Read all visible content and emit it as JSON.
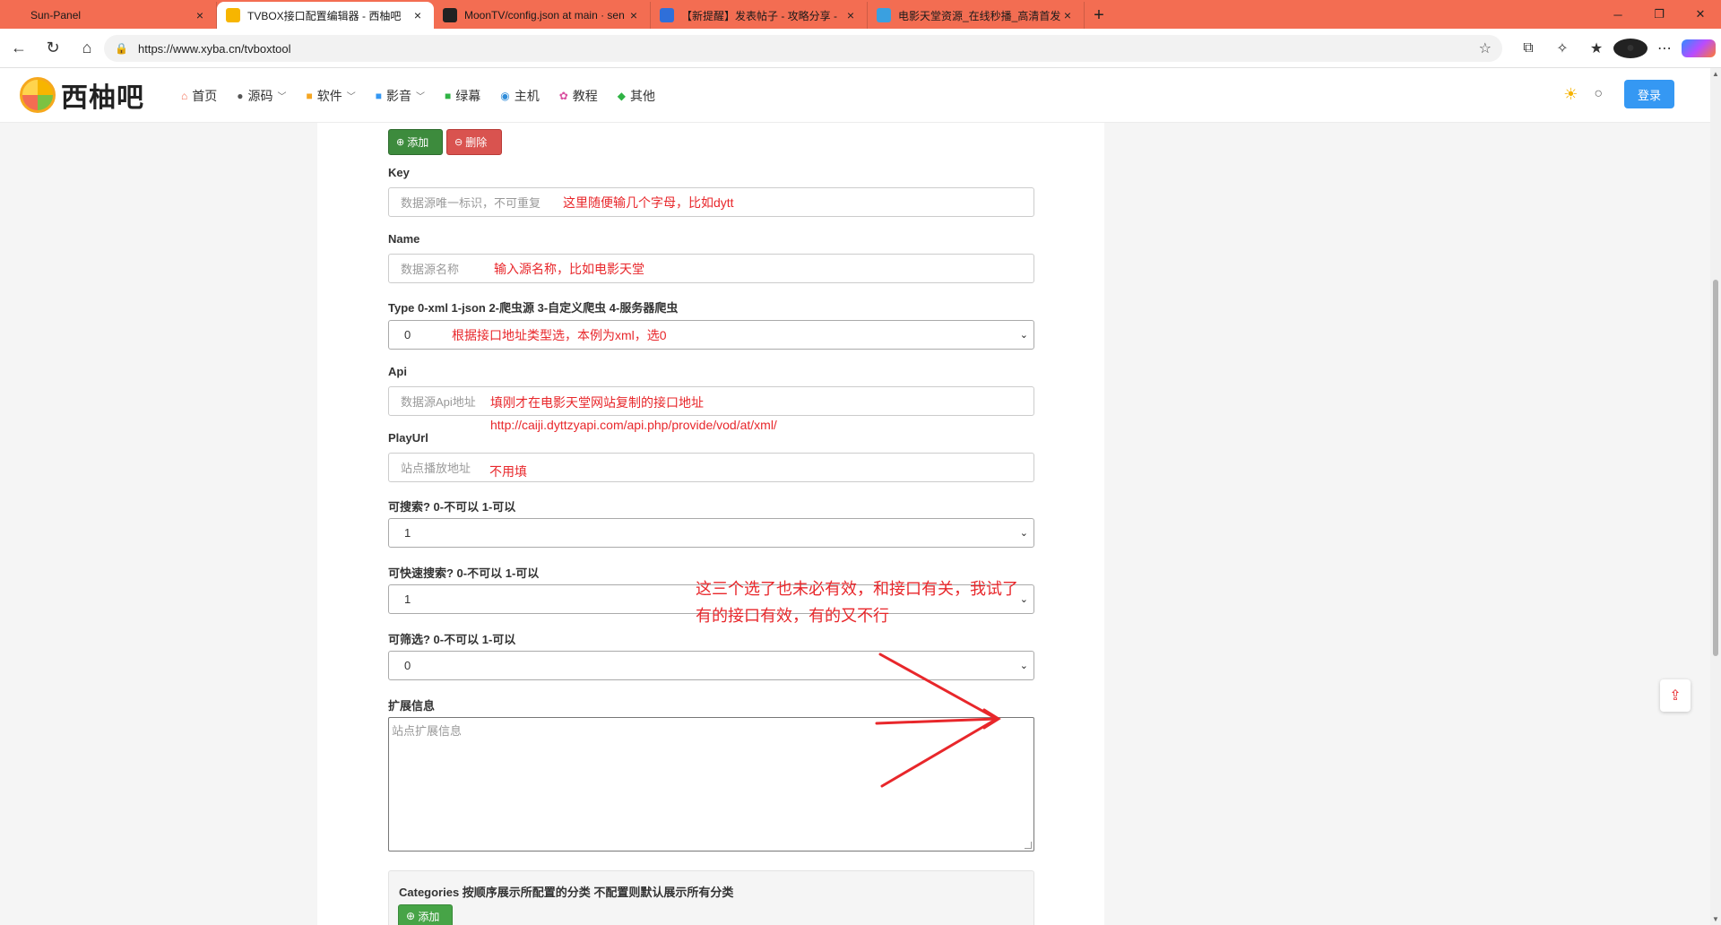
{
  "browser": {
    "tabs": [
      {
        "title": "Sun-Panel",
        "favicon": "sun-panel-icon",
        "color": "#f36d52",
        "active": false
      },
      {
        "title": "TVBOX接口配置编辑器 - 西柚吧",
        "favicon": "xiyouba-icon",
        "color": "#f7b500",
        "active": true
      },
      {
        "title": "MoonTV/config.json at main · sen",
        "favicon": "github-icon",
        "color": "#222222",
        "active": false
      },
      {
        "title": "【新提醒】发表帖子 - 攻略分享 -",
        "favicon": "forum-icon",
        "color": "#2f6fd9",
        "active": false
      },
      {
        "title": "电影天堂资源_在线秒播_高清首发",
        "favicon": "dytt-icon",
        "color": "#3aa0e0",
        "active": false
      }
    ],
    "close_glyph": "×",
    "new_tab_glyph": "+",
    "url": "https://www.xyba.cn/tvboxtool"
  },
  "site": {
    "logo_text": "西柚吧",
    "menu": [
      {
        "label": "首页",
        "icon": "home-icon",
        "glyph": "⌂",
        "color": "#f36d52",
        "dropdown": false
      },
      {
        "label": "源码",
        "icon": "github-icon",
        "glyph": "●",
        "color": "#555555",
        "dropdown": true
      },
      {
        "label": "软件",
        "icon": "software-icon",
        "glyph": "■",
        "color": "#f5a623",
        "dropdown": true
      },
      {
        "label": "影音",
        "icon": "media-icon",
        "glyph": "■",
        "color": "#3598f3",
        "dropdown": true
      },
      {
        "label": "绿幕",
        "icon": "greenscreen-icon",
        "glyph": "■",
        "color": "#2fb344",
        "dropdown": false
      },
      {
        "label": "主机",
        "icon": "globe-icon",
        "glyph": "◉",
        "color": "#2f8cd9",
        "dropdown": false
      },
      {
        "label": "教程",
        "icon": "tutorial-icon",
        "glyph": "✿",
        "color": "#d94fa0",
        "dropdown": false
      },
      {
        "label": "其他",
        "icon": "other-icon",
        "glyph": "◆",
        "color": "#2fb344",
        "dropdown": false
      }
    ],
    "login_label": "登录"
  },
  "form": {
    "add_label": "添加",
    "delete_label": "删除",
    "key_label": "Key",
    "key_placeholder": "数据源唯一标识，不可重复",
    "name_label": "Name",
    "name_placeholder": "数据源名称",
    "type_label": "Type 0-xml 1-json 2-爬虫源 3-自定义爬虫 4-服务器爬虫",
    "type_value": "0",
    "api_label": "Api",
    "api_placeholder": "数据源Api地址",
    "playurl_label": "PlayUrl",
    "playurl_placeholder": "站点播放地址",
    "searchable_label": "可搜索? 0-不可以 1-可以",
    "searchable_value": "1",
    "quicksearch_label": "可快速搜索? 0-不可以 1-可以",
    "quicksearch_value": "1",
    "filterable_label": "可筛选? 0-不可以 1-可以",
    "filterable_value": "0",
    "ext_label": "扩展信息",
    "ext_placeholder": "站点扩展信息",
    "categories_title": "Categories 按顺序展示所配置的分类 不配置则默认展示所有分类",
    "categories_add_label": "添加"
  },
  "annotations": {
    "key_note": "这里随便输几个字母，比如dytt",
    "name_note": "输入源名称，比如电影天堂",
    "type_note": "根据接口地址类型选，本例为xml，选0",
    "api_note_1": "填刚才在电影天堂网站复制的接口地址",
    "api_note_2": "http://caiji.dyttzyapi.com/api.php/provide/vod/at/xml/",
    "playurl_note": "不用填",
    "options_note": "这三个选了也未必有效，和接口有关，我试了有的接口有效，有的又不行"
  },
  "colors": {
    "annotation_red": "#e8272b",
    "tabstrip": "#f36d52",
    "login_blue": "#3598f3",
    "add_green": "#3d8b3d",
    "delete_red": "#d9534f"
  }
}
